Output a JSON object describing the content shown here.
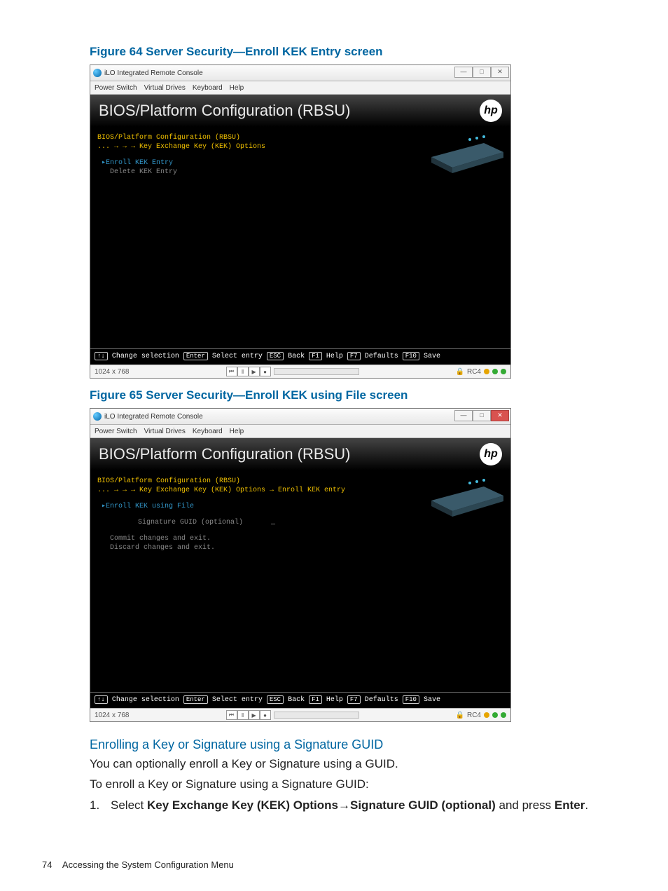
{
  "figures": [
    {
      "caption": "Figure 64 Server Security—Enroll KEK Entry screen",
      "window_title": "iLO Integrated Remote Console",
      "close_style": "normal",
      "menubar": [
        "Power Switch",
        "Virtual Drives",
        "Keyboard",
        "Help"
      ],
      "bios_title": "BIOS/Platform Configuration (RBSU)",
      "breadcrumb_root": "BIOS/Platform Configuration (RBSU)",
      "breadcrumb_sub": "... → → → Key Exchange Key (KEK) Options",
      "menu": [
        {
          "label": "Enroll KEK Entry",
          "selected": true
        },
        {
          "label": "Delete KEK Entry",
          "selected": false
        }
      ],
      "fields": [],
      "keys": [
        {
          "cap": "↑↓",
          "label": "Change selection"
        },
        {
          "cap": "Enter",
          "label": "Select entry"
        },
        {
          "cap": "ESC",
          "label": "Back"
        },
        {
          "cap": "F1",
          "label": "Help"
        },
        {
          "cap": "F7",
          "label": "Defaults"
        },
        {
          "cap": "F10",
          "label": "Save"
        }
      ],
      "resolution": "1024 x 768",
      "rc_label": "RC4"
    },
    {
      "caption": "Figure 65 Server Security—Enroll KEK using File screen",
      "window_title": "iLO Integrated Remote Console",
      "close_style": "red",
      "menubar": [
        "Power Switch",
        "Virtual Drives",
        "Keyboard",
        "Help"
      ],
      "bios_title": "BIOS/Platform Configuration (RBSU)",
      "breadcrumb_root": "BIOS/Platform Configuration (RBSU)",
      "breadcrumb_sub": "... → → → Key Exchange Key (KEK) Options → Enroll KEK entry",
      "menu": [
        {
          "label": "Enroll KEK using File",
          "selected": true
        }
      ],
      "fields": [
        {
          "label": "Signature GUID (optional)",
          "value": "_"
        }
      ],
      "extra_lines": [
        "Commit changes and exit.",
        "Discard changes and exit."
      ],
      "keys": [
        {
          "cap": "↑↓",
          "label": "Change selection"
        },
        {
          "cap": "Enter",
          "label": "Select entry"
        },
        {
          "cap": "ESC",
          "label": "Back"
        },
        {
          "cap": "F1",
          "label": "Help"
        },
        {
          "cap": "F7",
          "label": "Defaults"
        },
        {
          "cap": "F10",
          "label": "Save"
        }
      ],
      "resolution": "1024 x 768",
      "rc_label": "RC4"
    }
  ],
  "section_heading": "Enrolling a Key or Signature using a Signature GUID",
  "body_line1": "You can optionally enroll a Key or Signature using a GUID.",
  "body_line2": "To enroll a Key or Signature using a Signature GUID:",
  "step1_num": "1.",
  "step1_pre": "Select ",
  "step1_b1": "Key Exchange Key (KEK) Options",
  "step1_arrow": "→",
  "step1_b2": "Signature GUID (optional)",
  "step1_mid": " and press ",
  "step1_b3": "Enter",
  "step1_end": ".",
  "footer_page": "74",
  "footer_text": "Accessing the System Configuration Menu"
}
